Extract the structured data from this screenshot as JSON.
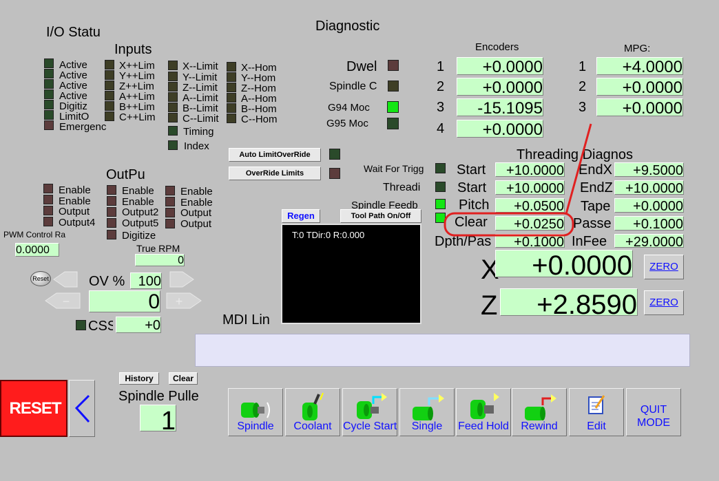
{
  "titles": {
    "io_status": "I/O Statu",
    "diagnostics": "Diagnostic",
    "inputs": "Inputs",
    "outputs": "OutPu",
    "encoders": "Encoders",
    "mpg": "MPG:",
    "threading": "Threading Diagnos"
  },
  "io": {
    "col1": [
      "Active",
      "Active",
      "Active",
      "Active",
      "Digitiz",
      "LimitO",
      "Emergenc"
    ],
    "col2": [
      "X++Lim",
      "Y++Lim",
      "Z++Lim",
      "A++Lim",
      "B++Lim",
      "C++Lim"
    ],
    "col3": [
      "X--Limit",
      "Y--Limit",
      "Z--Limit",
      "A--Limit",
      "B--Limit",
      "C--Limit"
    ],
    "col4": [
      "X--Hom",
      "Y--Hom",
      "Z--Hom",
      "A--Hom",
      "B--Hom",
      "C--Hom"
    ],
    "timing": "Timing",
    "index": "Index"
  },
  "outputs": {
    "col1": [
      "Enable",
      "Enable",
      "Output",
      "Output4"
    ],
    "col2": [
      "Enable",
      "Enable",
      "Output2",
      "Output5",
      "Digitize"
    ],
    "col3": [
      "Enable",
      "Enable",
      "Output",
      "Output"
    ]
  },
  "pwm": {
    "label": "PWM Control Ra",
    "value": "0.0000"
  },
  "true_rpm": {
    "label": "True RPM",
    "value": "0"
  },
  "override": {
    "reset_label": "Reset",
    "ov_label": "OV %",
    "ov_value": "100",
    "spindle_value": "0",
    "css_label": "CSS",
    "css_value": "+0"
  },
  "diag": {
    "dwell": "Dwel",
    "spindle": "Spindle C",
    "g94": "G94 Moc",
    "g95": "G95 Moc"
  },
  "encoders": [
    {
      "n": "1",
      "v": "+0.0000"
    },
    {
      "n": "2",
      "v": "+0.0000"
    },
    {
      "n": "3",
      "v": "-15.1095"
    },
    {
      "n": "4",
      "v": "+0.0000"
    }
  ],
  "mpg": [
    {
      "n": "1",
      "v": "+4.0000"
    },
    {
      "n": "2",
      "v": "+0.0000"
    },
    {
      "n": "3",
      "v": "+0.0000"
    }
  ],
  "limits": {
    "auto_override": "Auto LimitOverRide",
    "override": "OverRide Limits"
  },
  "wait": {
    "wait_trig": "Wait For Trigg",
    "threading": "Threadi",
    "spindle_feed": "Spindle Feedb"
  },
  "threading": {
    "left": [
      {
        "label": "Start",
        "v": "+10.0000"
      },
      {
        "label": "Start",
        "v": "+10.0000"
      },
      {
        "label": "Pitch",
        "v": "+0.0500"
      },
      {
        "label": "Clear",
        "v": "+0.0250"
      },
      {
        "label": "Dpth/Pas",
        "v": "+0.1000"
      }
    ],
    "right": [
      {
        "label": "EndX",
        "v": "+9.5000"
      },
      {
        "label": "EndZ",
        "v": "+10.0000"
      },
      {
        "label": "Tape",
        "v": "+0.0000"
      },
      {
        "label": "Passe",
        "v": "+0.1000"
      },
      {
        "label": "InFee",
        "v": "+29.0000"
      }
    ]
  },
  "toolpath": {
    "regen": "Regen",
    "toggle": "Tool Path On/Off",
    "readout": "T:0 TDir:0 R:0.000"
  },
  "axes": {
    "x_label": "X",
    "x_value": "+0.0000",
    "z_label": "Z",
    "z_value": "+2.8590",
    "zero": "ZERO"
  },
  "mdi": {
    "label": "MDI Lin",
    "value": ""
  },
  "history": {
    "history": "History",
    "clear": "Clear"
  },
  "pulley": {
    "label": "Spindle Pulle",
    "value": "1"
  },
  "reset_button": "RESET",
  "buttons": [
    "Spindle",
    "Coolant",
    "Cycle Start",
    "Single",
    "Feed Hold",
    "Rewind",
    "Edit"
  ],
  "quit": {
    "line1": "QUIT",
    "line2": "MODE"
  },
  "colors": {
    "background": "#c0c0c0",
    "dro": "#c8ffc8",
    "led_on": "#14e614",
    "reset": "#ff1c1c",
    "link_blue": "#1010ff",
    "annotation": "#e02020"
  }
}
